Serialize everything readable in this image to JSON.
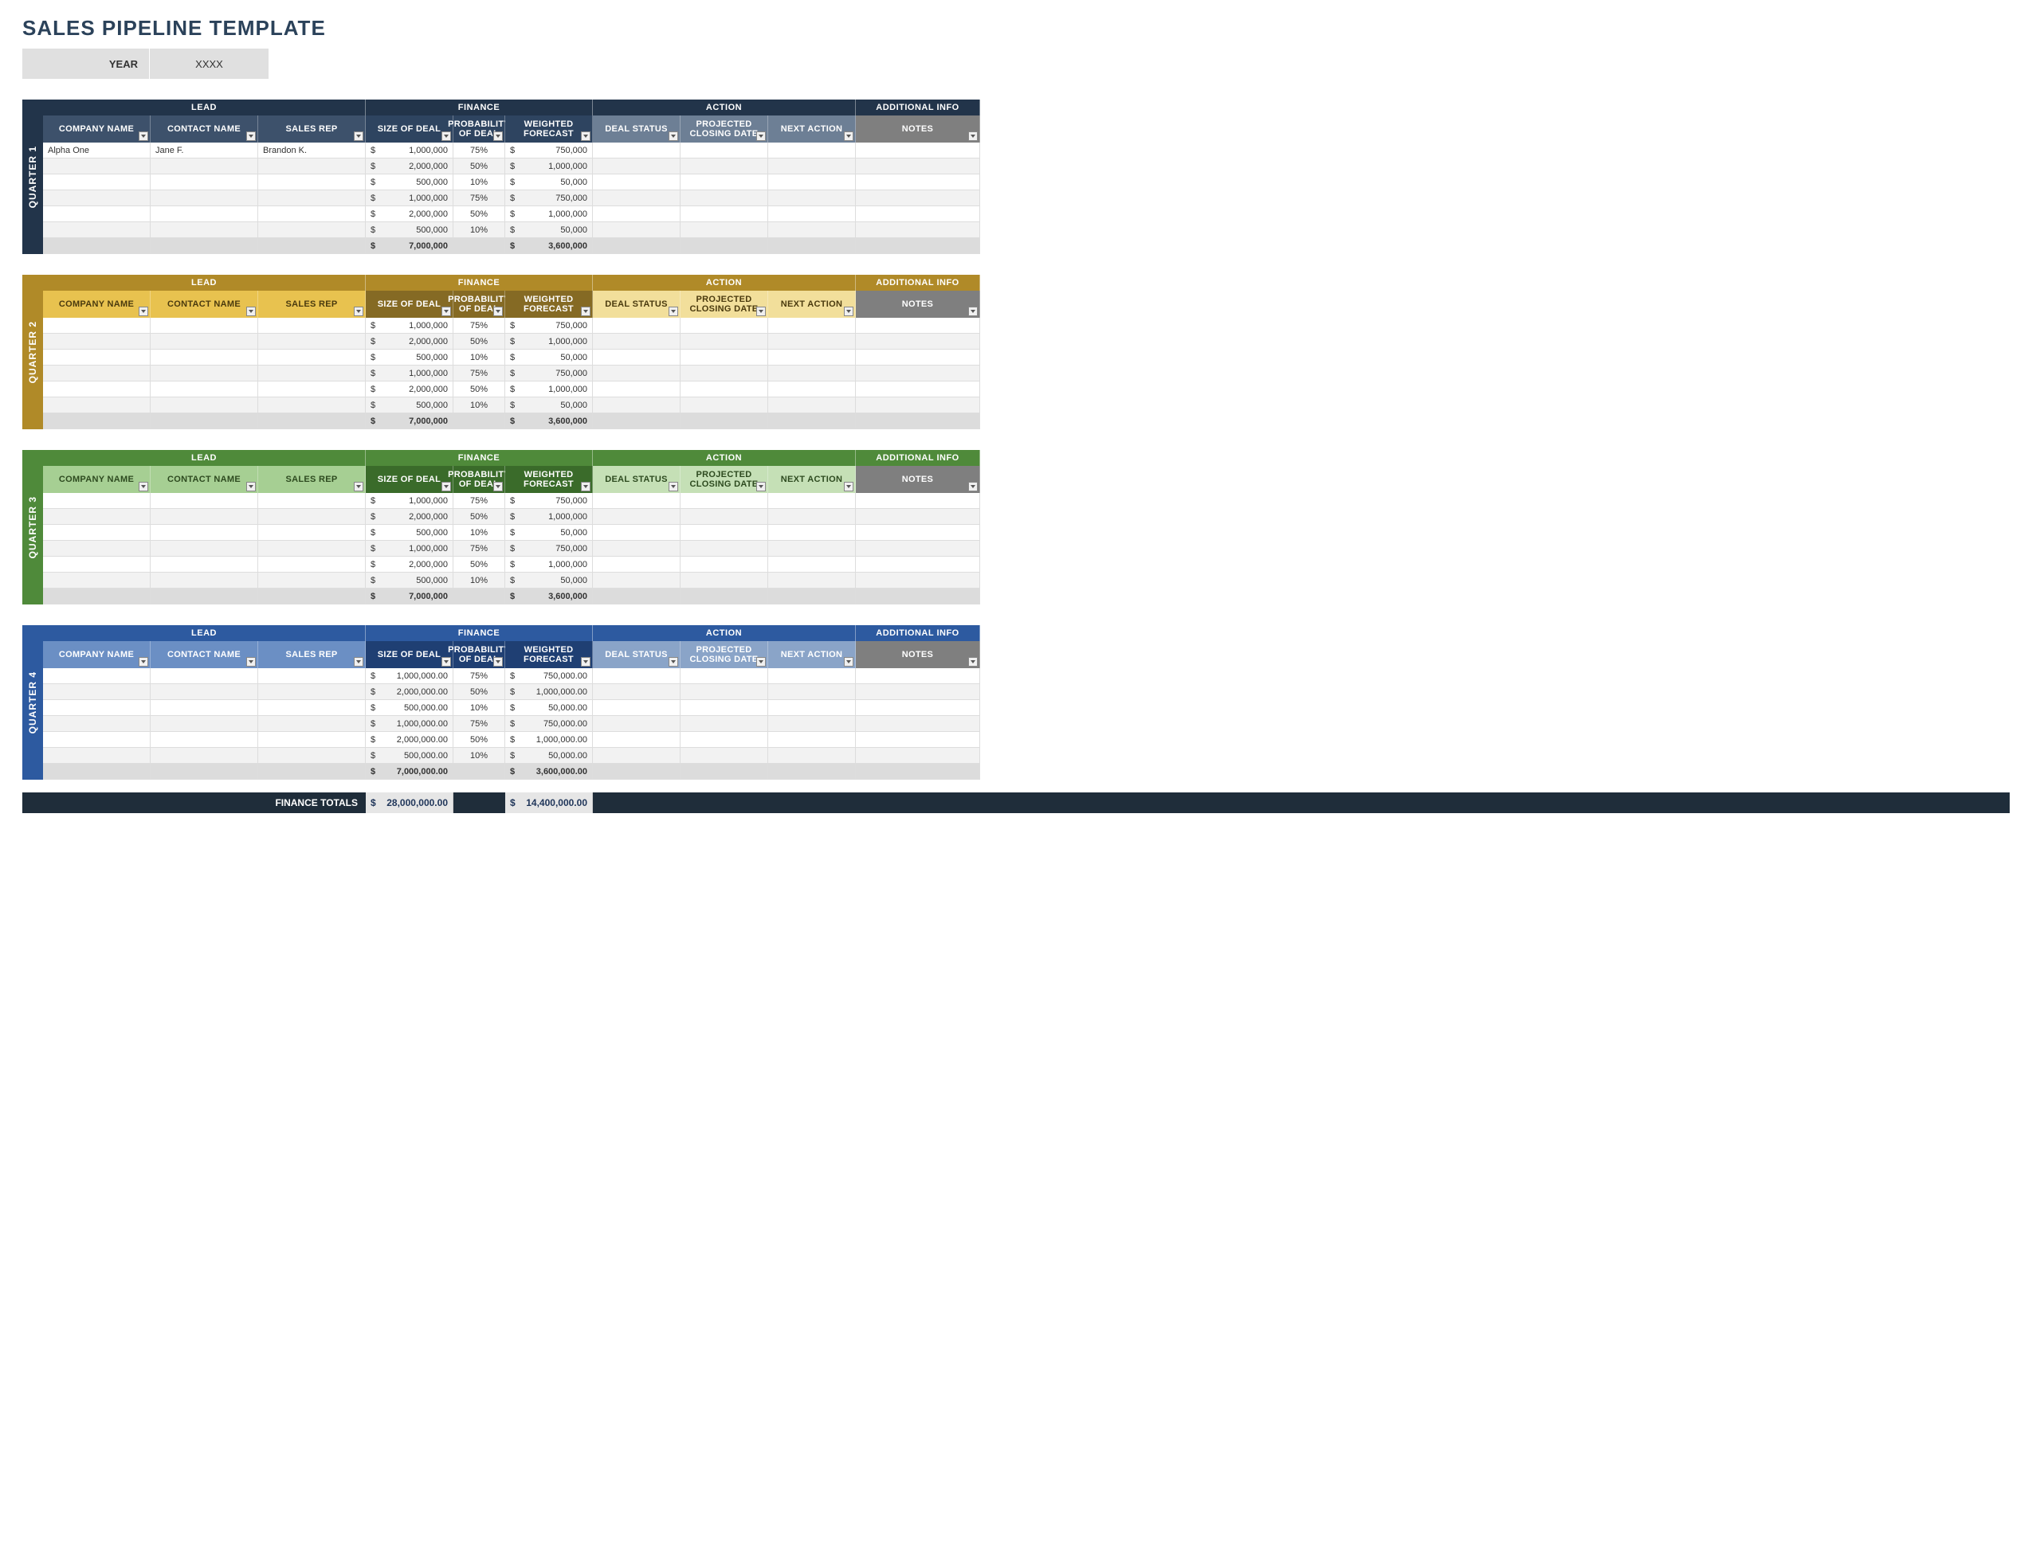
{
  "title": "SALES PIPELINE TEMPLATE",
  "year": {
    "label": "YEAR",
    "value": "XXXX"
  },
  "groups": {
    "lead": "LEAD",
    "finance": "FINANCE",
    "action": "ACTION",
    "info": "ADDITIONAL INFO"
  },
  "cols": {
    "company": "COMPANY NAME",
    "contact": "CONTACT NAME",
    "rep": "SALES REP",
    "size": "SIZE OF DEAL",
    "prob": "PROBABILITY OF DEAL",
    "fcst": "WEIGHTED FORECAST",
    "status": "DEAL STATUS",
    "close": "PROJECTED CLOSING DATE",
    "next": "NEXT ACTION",
    "notes": "NOTES"
  },
  "currency": "$",
  "quarters": [
    {
      "id": "q1",
      "label": "QUARTER 1",
      "rows": [
        {
          "company": "Alpha One",
          "contact": "Jane F.",
          "rep": "Brandon K.",
          "size": "1,000,000",
          "prob": "75%",
          "fcst": "750,000"
        },
        {
          "company": "",
          "contact": "",
          "rep": "",
          "size": "2,000,000",
          "prob": "50%",
          "fcst": "1,000,000"
        },
        {
          "company": "",
          "contact": "",
          "rep": "",
          "size": "500,000",
          "prob": "10%",
          "fcst": "50,000"
        },
        {
          "company": "",
          "contact": "",
          "rep": "",
          "size": "1,000,000",
          "prob": "75%",
          "fcst": "750,000"
        },
        {
          "company": "",
          "contact": "",
          "rep": "",
          "size": "2,000,000",
          "prob": "50%",
          "fcst": "1,000,000"
        },
        {
          "company": "",
          "contact": "",
          "rep": "",
          "size": "500,000",
          "prob": "10%",
          "fcst": "50,000"
        }
      ],
      "totals": {
        "size": "7,000,000",
        "fcst": "3,600,000"
      }
    },
    {
      "id": "q2",
      "label": "QUARTER 2",
      "rows": [
        {
          "company": "",
          "contact": "",
          "rep": "",
          "size": "1,000,000",
          "prob": "75%",
          "fcst": "750,000"
        },
        {
          "company": "",
          "contact": "",
          "rep": "",
          "size": "2,000,000",
          "prob": "50%",
          "fcst": "1,000,000"
        },
        {
          "company": "",
          "contact": "",
          "rep": "",
          "size": "500,000",
          "prob": "10%",
          "fcst": "50,000"
        },
        {
          "company": "",
          "contact": "",
          "rep": "",
          "size": "1,000,000",
          "prob": "75%",
          "fcst": "750,000"
        },
        {
          "company": "",
          "contact": "",
          "rep": "",
          "size": "2,000,000",
          "prob": "50%",
          "fcst": "1,000,000"
        },
        {
          "company": "",
          "contact": "",
          "rep": "",
          "size": "500,000",
          "prob": "10%",
          "fcst": "50,000"
        }
      ],
      "totals": {
        "size": "7,000,000",
        "fcst": "3,600,000"
      }
    },
    {
      "id": "q3",
      "label": "QUARTER 3",
      "rows": [
        {
          "company": "",
          "contact": "",
          "rep": "",
          "size": "1,000,000",
          "prob": "75%",
          "fcst": "750,000"
        },
        {
          "company": "",
          "contact": "",
          "rep": "",
          "size": "2,000,000",
          "prob": "50%",
          "fcst": "1,000,000"
        },
        {
          "company": "",
          "contact": "",
          "rep": "",
          "size": "500,000",
          "prob": "10%",
          "fcst": "50,000"
        },
        {
          "company": "",
          "contact": "",
          "rep": "",
          "size": "1,000,000",
          "prob": "75%",
          "fcst": "750,000"
        },
        {
          "company": "",
          "contact": "",
          "rep": "",
          "size": "2,000,000",
          "prob": "50%",
          "fcst": "1,000,000"
        },
        {
          "company": "",
          "contact": "",
          "rep": "",
          "size": "500,000",
          "prob": "10%",
          "fcst": "50,000"
        }
      ],
      "totals": {
        "size": "7,000,000",
        "fcst": "3,600,000"
      }
    },
    {
      "id": "q4",
      "label": "QUARTER 4",
      "rows": [
        {
          "company": "",
          "contact": "",
          "rep": "",
          "size": "1,000,000.00",
          "prob": "75%",
          "fcst": "750,000.00"
        },
        {
          "company": "",
          "contact": "",
          "rep": "",
          "size": "2,000,000.00",
          "prob": "50%",
          "fcst": "1,000,000.00"
        },
        {
          "company": "",
          "contact": "",
          "rep": "",
          "size": "500,000.00",
          "prob": "10%",
          "fcst": "50,000.00"
        },
        {
          "company": "",
          "contact": "",
          "rep": "",
          "size": "1,000,000.00",
          "prob": "75%",
          "fcst": "750,000.00"
        },
        {
          "company": "",
          "contact": "",
          "rep": "",
          "size": "2,000,000.00",
          "prob": "50%",
          "fcst": "1,000,000.00"
        },
        {
          "company": "",
          "contact": "",
          "rep": "",
          "size": "500,000.00",
          "prob": "10%",
          "fcst": "50,000.00"
        }
      ],
      "totals": {
        "size": "7,000,000.00",
        "fcst": "3,600,000.00"
      }
    }
  ],
  "finance_totals": {
    "label": "FINANCE TOTALS",
    "size": "28,000,000.00",
    "fcst": "14,400,000.00"
  }
}
